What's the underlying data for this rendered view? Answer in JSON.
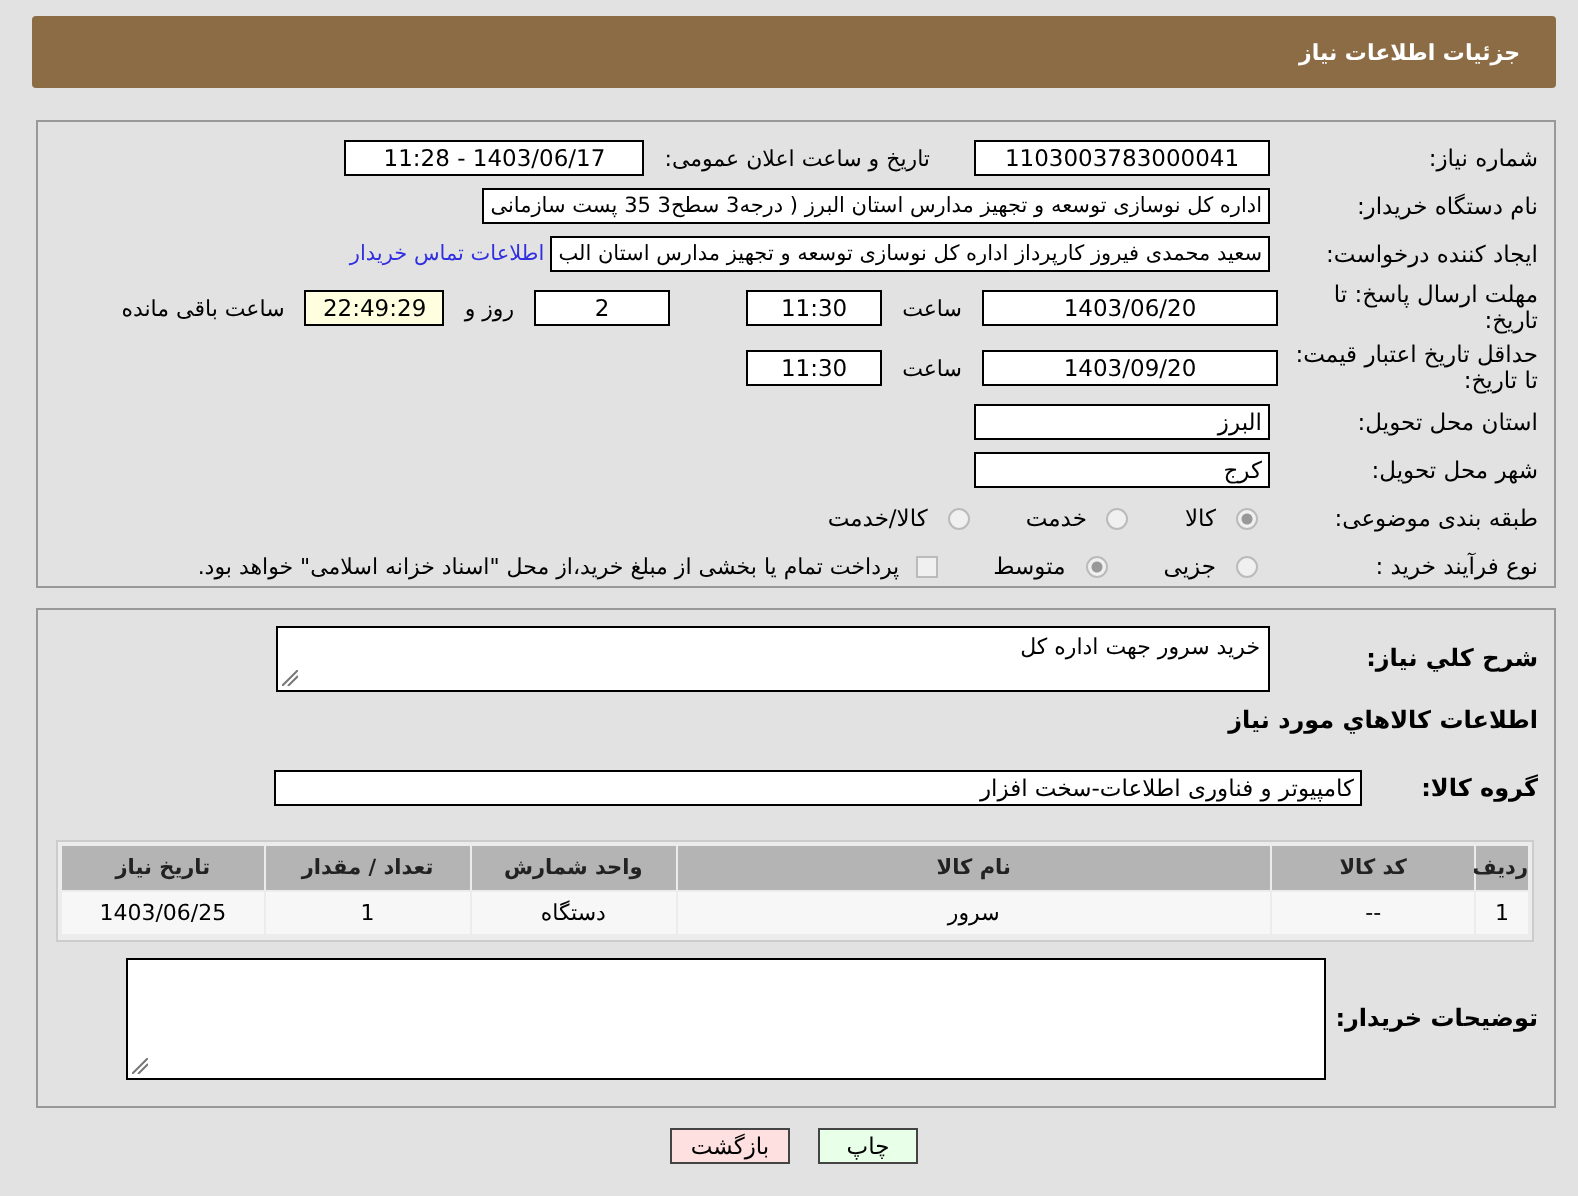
{
  "header": {
    "title": "جزئیات اطلاعات نیاز"
  },
  "details": {
    "need_number": {
      "label": "شماره نیاز:",
      "value": "1103003783000041"
    },
    "announce": {
      "label": "تاریخ و ساعت اعلان عمومی:",
      "value": "1403/06/17 - 11:28"
    },
    "buyer": {
      "label": "نام دستگاه خریدار:",
      "value": "اداره کل نوسازی   توسعه و تجهیز مدارس استان البرز ( درجه3  سطح3  35 پست سازمانی"
    },
    "requester": {
      "label": "ایجاد کننده درخواست:",
      "value": "سعید محمدی فیروز کارپرداز اداره کل نوسازی   توسعه و تجهیز مدارس استان الب",
      "link": "اطلاعات تماس خریدار"
    },
    "reply_deadline": {
      "label": "مهلت ارسال پاسخ: تا تاریخ:",
      "date": "1403/06/20",
      "time_label": "ساعت",
      "time": "11:30",
      "days": "2",
      "days_label": "روز و",
      "remaining": "22:49:29",
      "remaining_label": "ساعت باقی مانده"
    },
    "price_validity": {
      "label": "حداقل تاریخ اعتبار قیمت: تا تاریخ:",
      "date": "1403/09/20",
      "time_label": "ساعت",
      "time": "11:30"
    },
    "province": {
      "label": "استان محل تحویل:",
      "value": "البرز"
    },
    "city": {
      "label": "شهر محل تحویل:",
      "value": "کرج"
    },
    "category": {
      "label": "طبقه بندی موضوعی:",
      "options": [
        {
          "label": "کالا",
          "selected": true
        },
        {
          "label": "خدمت",
          "selected": false
        },
        {
          "label": "کالا/خدمت",
          "selected": false
        }
      ]
    },
    "process": {
      "label": "نوع فرآیند خرید :",
      "options": [
        {
          "label": "جزیی",
          "selected": false
        },
        {
          "label": "متوسط",
          "selected": true
        }
      ],
      "treasury": {
        "label": "پرداخت تمام یا بخشی از مبلغ خرید،از محل \"اسناد خزانه اسلامی\" خواهد بود.",
        "checked": false
      }
    }
  },
  "summary": {
    "label": "شرح کلي نياز:",
    "value": "خرید سرور جهت اداره کل"
  },
  "goods": {
    "heading": "اطلاعات کالاهاي مورد نياز",
    "group_label": "گروه کالا:",
    "group": "کامپیوتر و فناوری اطلاعات-سخت افزار",
    "table": {
      "columns": [
        "ردیف",
        "کد کالا",
        "نام کالا",
        "واحد شمارش",
        "تعداد / مقدار",
        "تاریخ نیاز"
      ],
      "rows": [
        [
          "1",
          "--",
          "سرور",
          "دستگاه",
          "1",
          "1403/06/25"
        ]
      ]
    }
  },
  "buyer_notes": {
    "label": "توضیحات خریدار:"
  },
  "buttons": [
    {
      "label": "چاپ",
      "kind": "print"
    },
    {
      "label": "بازگشت",
      "kind": "back"
    }
  ]
}
